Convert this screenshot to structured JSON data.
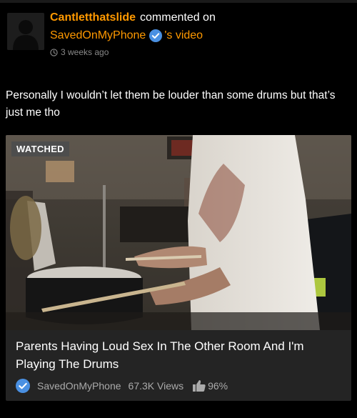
{
  "header": {
    "username": "Cantletthatslide",
    "action": "commented on",
    "channel": "SavedOnMyPhone",
    "suffix": "'s video",
    "time": "3 weeks ago"
  },
  "comment": {
    "text": "Personally I wouldn’t let them be louder than some drums but that’s just me tho"
  },
  "video": {
    "badge": "WATCHED",
    "title": "Parents Having Loud Sex In The Other Room And I'm Playing The Drums",
    "channel": "SavedOnMyPhone",
    "views": "67.3K Views",
    "rating": "96%"
  },
  "icons": {
    "verified": "verified-check-icon",
    "clock": "clock-icon",
    "thumb": "thumbs-up-icon"
  },
  "colors": {
    "accent": "#ff9900",
    "verified": "#4a90e2",
    "background": "#000000"
  }
}
